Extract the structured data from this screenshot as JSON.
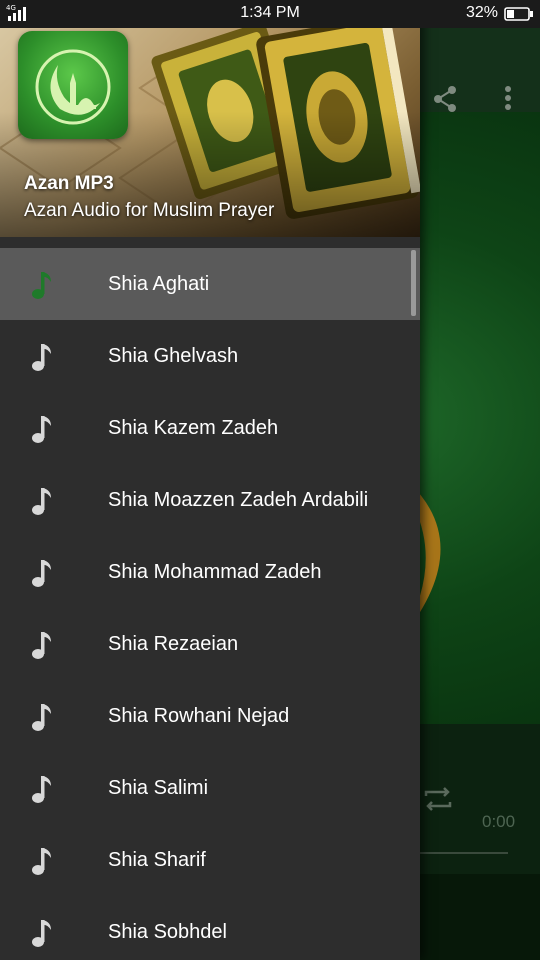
{
  "status_bar": {
    "network": "4G",
    "time": "1:34 PM",
    "battery_percent": "32%"
  },
  "drawer": {
    "header": {
      "app_title": "Azan MP3",
      "app_subtitle": "Azan Audio for Muslim Prayer"
    },
    "items": [
      {
        "label": "Shia Aghati",
        "icon": "music-note-icon",
        "active": true
      },
      {
        "label": "Shia Ghelvash",
        "icon": "music-note-icon",
        "active": false
      },
      {
        "label": "Shia Kazem Zadeh",
        "icon": "music-note-icon",
        "active": false
      },
      {
        "label": "Shia Moazzen Zadeh Ardabili",
        "icon": "music-note-icon",
        "active": false
      },
      {
        "label": "Shia Mohammad Zadeh",
        "icon": "music-note-icon",
        "active": false
      },
      {
        "label": "Shia Rezaeian",
        "icon": "music-note-icon",
        "active": false
      },
      {
        "label": "Shia Rowhani Nejad",
        "icon": "music-note-icon",
        "active": false
      },
      {
        "label": "Shia Salimi",
        "icon": "music-note-icon",
        "active": false
      },
      {
        "label": "Shia Sharif",
        "icon": "music-note-icon",
        "active": false
      },
      {
        "label": "Shia Sobhdel",
        "icon": "music-note-icon",
        "active": false
      }
    ]
  },
  "background_app": {
    "toolbar_icons": [
      "share-icon",
      "more-vert-icon"
    ],
    "player": {
      "elapsed_time": "0:00",
      "icons": [
        "repeat-icon"
      ]
    }
  },
  "colors": {
    "drawer_bg": "#2d2d2d",
    "active_item_bg": "#5a5a5a",
    "active_icon": "#1f7a2a",
    "inactive_icon": "#d8d8d8",
    "text": "#ffffff"
  }
}
